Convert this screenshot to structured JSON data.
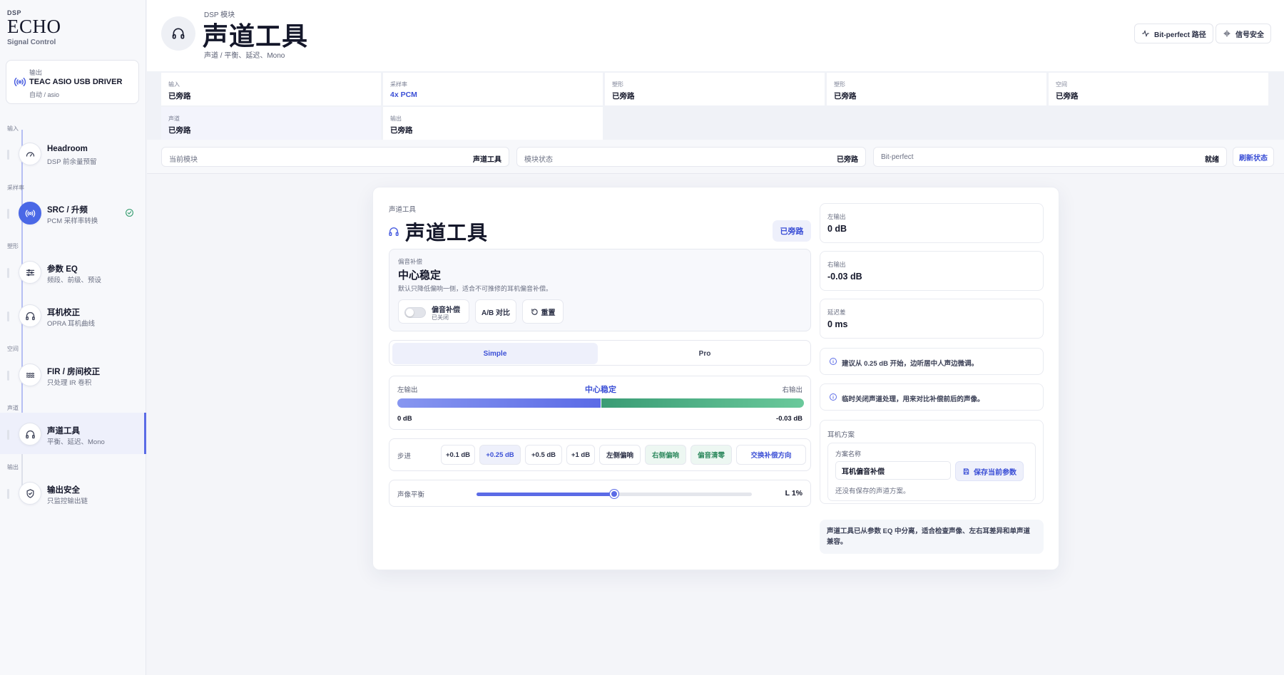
{
  "brand": {
    "kicker": "DSP",
    "name": "ECHO",
    "subtitle": "Signal Control"
  },
  "output_card": {
    "label": "输出",
    "device": "TEAC ASIO USB DRIVER",
    "mode": "自动 / asio"
  },
  "nav": {
    "sections": [
      "输入",
      "采样率",
      "塑形",
      "空间",
      "声道",
      "输出"
    ],
    "items": [
      {
        "title": "Headroom",
        "desc": "DSP 前余量预留",
        "icon": "gauge-icon"
      },
      {
        "title": "SRC / 升频",
        "desc": "PCM 采样率转换",
        "icon": "broadcast-icon"
      },
      {
        "title": "参数 EQ",
        "desc": "频段、前级、预设",
        "icon": "sliders-icon"
      },
      {
        "title": "耳机校正",
        "desc": "OPRA 耳机曲线",
        "icon": "headphones-icon"
      },
      {
        "title": "FIR / 房间校正",
        "desc": "只处理 IR 卷积",
        "icon": "waves-icon"
      },
      {
        "title": "声道工具",
        "desc": "平衡、延迟、Mono",
        "icon": "headphones-icon"
      },
      {
        "title": "输出安全",
        "desc": "只监控输出链",
        "icon": "shield-icon"
      }
    ]
  },
  "header": {
    "kicker": "DSP 模块",
    "title": "声道工具",
    "subtitle": "声道 / 平衡、延迟、Mono",
    "btn_bitperfect": "Bit-perfect 路径",
    "btn_safety": "信号安全"
  },
  "status_grid": [
    {
      "label": "输入",
      "value": "已旁路"
    },
    {
      "label": "采样率",
      "value": "4x PCM"
    },
    {
      "label": "塑形",
      "value": "已旁路"
    },
    {
      "label": "塑形",
      "value": "已旁路"
    },
    {
      "label": "空间",
      "value": "已旁路"
    },
    {
      "label": "声道",
      "value": "已旁路"
    },
    {
      "label": "输出",
      "value": "已旁路"
    }
  ],
  "strip": {
    "current_label": "当前模块",
    "current_value": "声道工具",
    "state_label": "模块状态",
    "state_value": "已旁路",
    "bp_label": "Bit-perfect",
    "bp_value": "就绪",
    "refresh": "刷新状态"
  },
  "panel": {
    "kicker": "声道工具",
    "title": "声道工具",
    "badge": "已旁路",
    "comp": {
      "label": "偏音补偿",
      "title": "中心稳定",
      "desc": "默认只降低偏响一侧，适合不可推修的耳机偏音补偿。",
      "toggle_label": "偏音补偿",
      "toggle_state": "已关闭",
      "ab_label": "A/B 对比",
      "reset_label": "重置"
    },
    "tabs": [
      "Simple",
      "Pro"
    ],
    "balance": {
      "left_label": "左输出",
      "center_label": "中心稳定",
      "right_label": "右输出",
      "left_value": "0 dB",
      "right_value": "-0.03 dB",
      "left_share": 0.5
    },
    "step": {
      "label": "步进",
      "chips": [
        "+0.1 dB",
        "+0.25 dB",
        "+0.5 dB",
        "+1 dB",
        "左侧偏响",
        "右侧偏响",
        "偏音清零",
        "交换补偿方向"
      ]
    },
    "pan": {
      "label": "声像平衡",
      "value": "L 1%",
      "position": 0.5
    }
  },
  "readouts": [
    {
      "label": "左输出",
      "value": "0 dB"
    },
    {
      "label": "右输出",
      "value": "-0.03 dB"
    },
    {
      "label": "延迟差",
      "value": "0 ms"
    }
  ],
  "tips": [
    "建议从 0.25 dB 开始，边听居中人声边微调。",
    "临时关闭声道处理，用来对比补偿前后的声像。"
  ],
  "presets": {
    "title": "耳机方案",
    "name_label": "方案名称",
    "name_value": "耳机偏音补偿",
    "save_label": "保存当前参数",
    "empty": "还没有保存的声道方案。"
  },
  "note": "声道工具已从参数 EQ 中分离，适合检查声像、左右耳差异和单声道兼容。",
  "colors": {
    "accent": "#5b6be6",
    "green": "#3a9c75",
    "bg": "#f4f5f9"
  }
}
